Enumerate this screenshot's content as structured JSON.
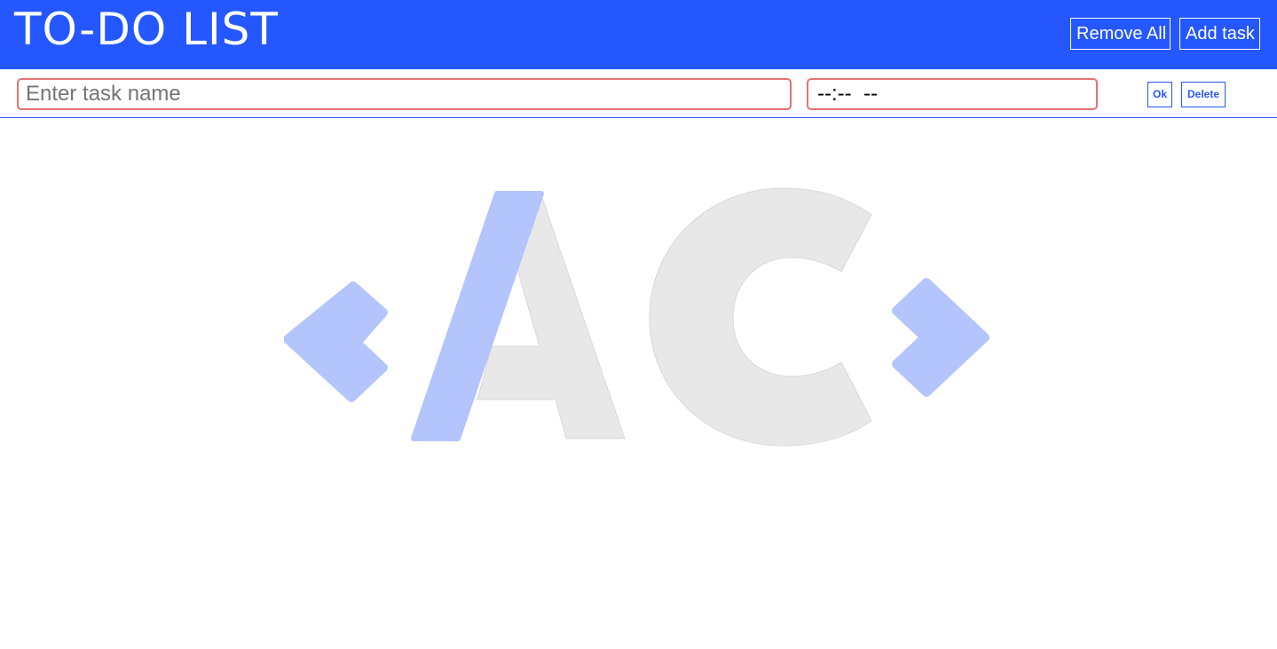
{
  "header": {
    "title": "TO-DO LIST",
    "remove_all_label": "Remove All",
    "add_task_label": "Add task"
  },
  "form": {
    "task_placeholder": "Enter task name",
    "time_value": "--:--  --",
    "ok_label": "Ok",
    "delete_label": "Delete"
  },
  "logo": {
    "icon": "ac-logo-icon"
  },
  "colors": {
    "brand": "#2557ff",
    "input_border": "#e57373",
    "logo_accent": "#b4c4fd",
    "logo_gray": "#e8e8e8"
  }
}
